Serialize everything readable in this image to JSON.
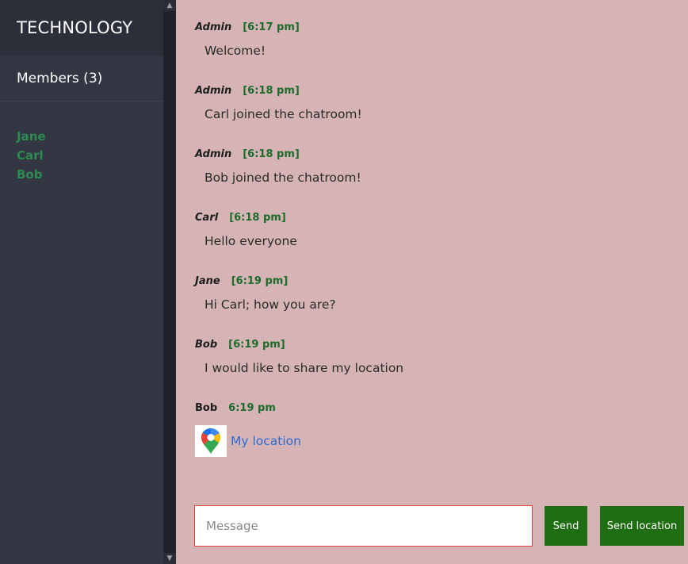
{
  "sidebar": {
    "room_title": "TECHNOLOGY",
    "members_heading": "Members (3)",
    "members": [
      "Jane",
      "Carl",
      "Bob"
    ]
  },
  "messages": [
    {
      "user": "Admin",
      "time": "[6:17 pm]",
      "text": "Welcome!"
    },
    {
      "user": "Admin",
      "time": "[6:18 pm]",
      "text": "Carl joined the chatroom!"
    },
    {
      "user": "Admin",
      "time": "[6:18 pm]",
      "text": "Bob joined the chatroom!"
    },
    {
      "user": "Carl",
      "time": "[6:18 pm]",
      "text": "Hello everyone"
    },
    {
      "user": "Jane",
      "time": "[6:19 pm]",
      "text": "Hi Carl; how you are?"
    },
    {
      "user": "Bob",
      "time": "[6:19 pm]",
      "text": "I would like to share my location"
    }
  ],
  "location_message": {
    "user": "Bob",
    "time": "6:19 pm",
    "link_text": "My location",
    "icon": "google-maps-pin-icon"
  },
  "composer": {
    "placeholder": "Message",
    "send_label": "Send",
    "send_location_label": "Send location"
  },
  "colors": {
    "sidebar_bg": "#333744",
    "chat_bg": "#d6b4b6",
    "member_name": "#2d8a51",
    "timestamp": "#1b6b2b",
    "button_bg": "#1f6e12",
    "link": "#2f6ad0"
  }
}
